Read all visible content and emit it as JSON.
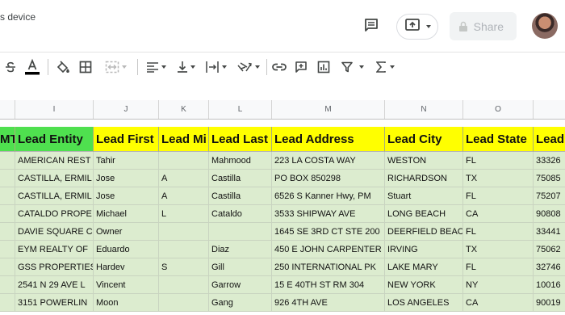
{
  "header": {
    "device_text": "s device",
    "share_label": "Share"
  },
  "icons": {
    "comment": "comment-icon",
    "present": "present-icon",
    "lock": "lock-icon"
  },
  "columns": [
    "",
    "I",
    "J",
    "K",
    "L",
    "M",
    "N",
    "O",
    ""
  ],
  "header_row": [
    "MT",
    "Lead Entity",
    "Lead First",
    "Lead Mi",
    "Lead Last",
    "Lead Address",
    "Lead City",
    "Lead State",
    "Lead"
  ],
  "rows": [
    [
      "",
      "AMERICAN REST",
      "Tahir",
      "",
      "Mahmood",
      "223 LA COSTA WAY",
      "WESTON",
      "FL",
      "33326"
    ],
    [
      "",
      "CASTILLA, ERMIL",
      "Jose",
      "A",
      "Castilla",
      "PO BOX 850298",
      "RICHARDSON",
      "TX",
      "75085"
    ],
    [
      "",
      "CASTILLA, ERMIL",
      "Jose",
      "A",
      "Castilla",
      "6526 S Kanner Hwy, PM",
      "Stuart",
      "FL",
      "75207"
    ],
    [
      "",
      "CATALDO PROPE",
      "Michael",
      "L",
      "Cataldo",
      "3533 SHIPWAY AVE",
      "LONG BEACH",
      "CA",
      "90808"
    ],
    [
      "",
      "DAVIE SQUARE C",
      "Owner",
      "",
      "",
      "1645 SE 3RD CT STE 200",
      "DEERFIELD BEAC",
      "FL",
      "33441"
    ],
    [
      "",
      "EYM REALTY OF",
      "Eduardo",
      "",
      "Diaz",
      "450 E JOHN CARPENTER",
      "IRVING",
      "TX",
      "75062"
    ],
    [
      "",
      "GSS PROPERTIES",
      "Hardev",
      "S",
      "Gill",
      "250 INTERNATIONAL PK",
      "LAKE MARY",
      "FL",
      "32746"
    ],
    [
      "",
      "2541 N 29 AVE L",
      "Vincent",
      "",
      "Garrow",
      "15 E 40TH ST RM 304",
      "NEW YORK",
      "NY",
      "10016"
    ],
    [
      "",
      "3151 POWERLIN",
      "Moon",
      "",
      "Gang",
      "926 4TH AVE",
      "LOS ANGELES",
      "CA",
      "90019"
    ]
  ]
}
